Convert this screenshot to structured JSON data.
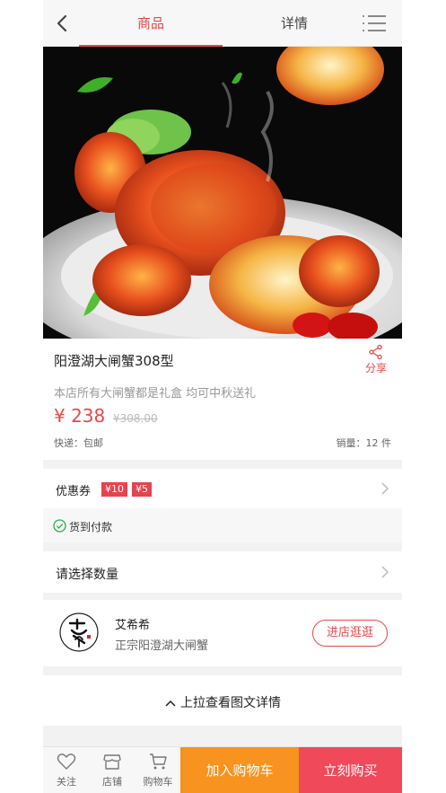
{
  "header": {
    "tabs": [
      {
        "label": "商品",
        "active": true
      },
      {
        "label": "详情",
        "active": false
      }
    ],
    "accent_color": "#e84848"
  },
  "product": {
    "title": "阳澄湖大闸蟹308型",
    "share_label": "分享",
    "description": "本店所有大闸蟹都是礼盒 均可中秋送礼",
    "price": "¥ 238",
    "original_price": "¥308.00",
    "shipping": "快递：包邮",
    "sales": "销量：12 件"
  },
  "coupon": {
    "label": "优惠券",
    "chips": [
      "¥10",
      "¥5"
    ]
  },
  "cod": {
    "label": "货到付款"
  },
  "quantity": {
    "label": "请选择数量"
  },
  "shop": {
    "name": "艾希希",
    "subtitle": "正宗阳澄湖大闸蟹",
    "enter_label": "进店逛逛"
  },
  "pull_up": {
    "label": "上拉查看图文详情"
  },
  "bottom_bar": {
    "favorite": "关注",
    "store": "店铺",
    "cart": "购物车",
    "add_to_cart": "加入购物车",
    "buy_now": "立刻购买",
    "add_color": "#f7931e",
    "buy_color": "#f0495a"
  }
}
